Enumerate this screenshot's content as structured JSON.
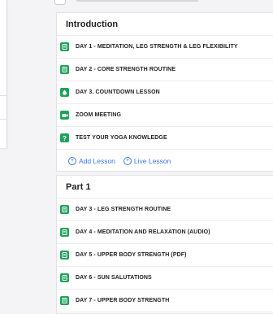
{
  "sections": [
    {
      "title": "Introduction",
      "lessons": [
        {
          "icon": "document-icon",
          "label": "DAY 1 - MEDITATION, LEG STRENGTH & LEG FLEXIBILITY"
        },
        {
          "icon": "document-icon",
          "label": "DAY 2 - CORE STRENGTH ROUTINE"
        },
        {
          "icon": "countdown-icon",
          "label": "DAY 3. COUNTDOWN LESSON"
        },
        {
          "icon": "video-camera-icon",
          "label": "ZOOM MEETING"
        },
        {
          "icon": "quiz-icon",
          "label": "TEST YOUR YOGA KNOWLEDGE"
        }
      ],
      "add_lesson": "Add Lesson",
      "live_lesson": "Live Lesson"
    },
    {
      "title": "Part 1",
      "lessons": [
        {
          "icon": "document-icon",
          "label": "DAY 3 - LEG STRENGTH ROUTINE"
        },
        {
          "icon": "document-icon",
          "label": "DAY 4 - MEDITATION AND RELAXATION (AUDIO)"
        },
        {
          "icon": "document-icon",
          "label": "DAY 5 - UPPER BODY STRENGTH (PDF)"
        },
        {
          "icon": "document-icon",
          "label": "DAY 6 - SUN SALUTATIONS"
        },
        {
          "icon": "document-icon",
          "label": "DAY 7 - UPPER BODY STRENGTH"
        }
      ]
    }
  ],
  "colors": {
    "accent": "#3a78e8",
    "lesson_icon": "#20a15c"
  }
}
